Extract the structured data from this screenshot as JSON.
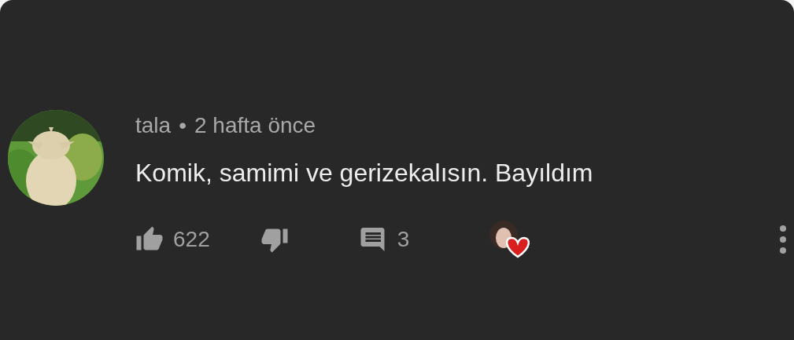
{
  "comment": {
    "author": "tala",
    "separator": "•",
    "time": "2 hafta önce",
    "text": "Komik, samimi ve gerizekalısın. Bayıldım",
    "likes": "622",
    "replies": "3",
    "hearted": true
  }
}
